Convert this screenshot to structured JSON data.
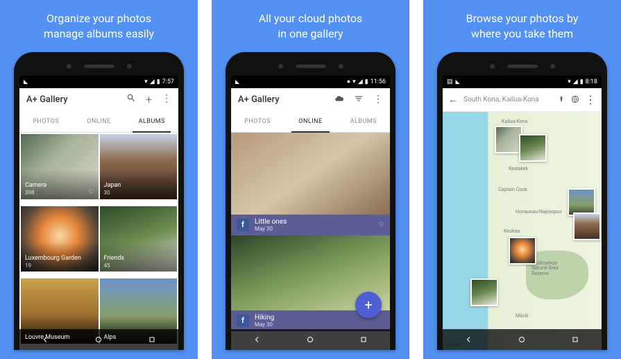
{
  "panels": [
    {
      "caption_l1": "Organize your photos",
      "caption_l2": "manage albums easily"
    },
    {
      "caption_l1": "All your cloud photos",
      "caption_l2": "in one gallery"
    },
    {
      "caption_l1": "Browse your photos by",
      "caption_l2": "where you take them"
    }
  ],
  "status": {
    "time1": "7:57",
    "time2": "11:56",
    "time3": "8:18"
  },
  "app": {
    "title": "A+ Gallery",
    "tabs": {
      "photos": "PHOTOS",
      "online": "ONLINE",
      "albums": "ALBUMS"
    }
  },
  "albums": [
    {
      "name": "Camera",
      "count": "398"
    },
    {
      "name": "Japan",
      "count": "30"
    },
    {
      "name": "Luxembourg Garden",
      "count": "19"
    },
    {
      "name": "Friends",
      "count": "45"
    },
    {
      "name": "Louvre Museum",
      "count": ""
    },
    {
      "name": "Alps",
      "count": ""
    }
  ],
  "online": [
    {
      "title": "Little ones",
      "date": "May 30"
    },
    {
      "title": "Hiking",
      "date": "May 30"
    }
  ],
  "map": {
    "location": "South Kona, Kailua-Kona",
    "attribution": "Google",
    "labels": {
      "kailua": "Kailua-Kona",
      "kealakek": "Kealakek",
      "captain": "Captain Cook",
      "honaunau": "Honaunau-Napoopoo",
      "keokea": "Keokea",
      "milolii": "Milolii",
      "park_l1": "Kīpāhoehoe",
      "park_l2": "Natural Area",
      "park_l3": "Reserve"
    }
  }
}
